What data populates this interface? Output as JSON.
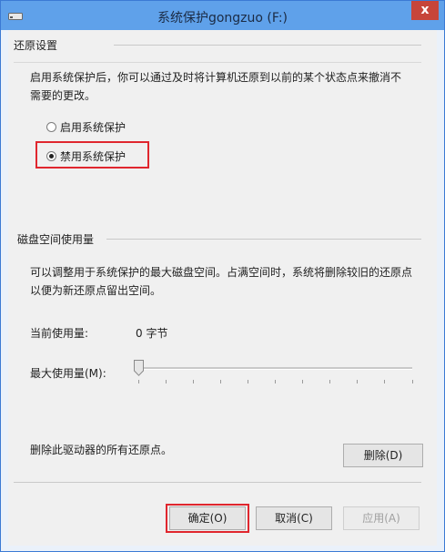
{
  "window": {
    "title": "系统保护gongzuo (F:)",
    "close_glyph": "x"
  },
  "restore_settings": {
    "group_title": "还原设置",
    "description": "启用系统保护后，你可以通过及时将计算机还原到以前的某个状态点来撤消不需要的更改。",
    "option_enable": "启用系统保护",
    "option_disable": "禁用系统保护",
    "selected": "禁用系统保护"
  },
  "disk_usage": {
    "group_title": "磁盘空间使用量",
    "description": "可以调整用于系统保护的最大磁盘空间。占满空间时，系统将删除较旧的还原点以便为新还原点留出空间。",
    "current_label": "当前使用量:",
    "current_value": "0 字节",
    "max_label": "最大使用量(M):",
    "slider_level": 0,
    "delete_desc": "删除此驱动器的所有还原点。",
    "delete_button": "删除(D)"
  },
  "footer": {
    "ok_button": "确定(O)",
    "cancel_button": "取消(C)",
    "apply_button": "应用(A)"
  },
  "colors": {
    "titlebar": "#5fa1ea",
    "highlight": "#e0262e",
    "close": "#c7453a"
  }
}
